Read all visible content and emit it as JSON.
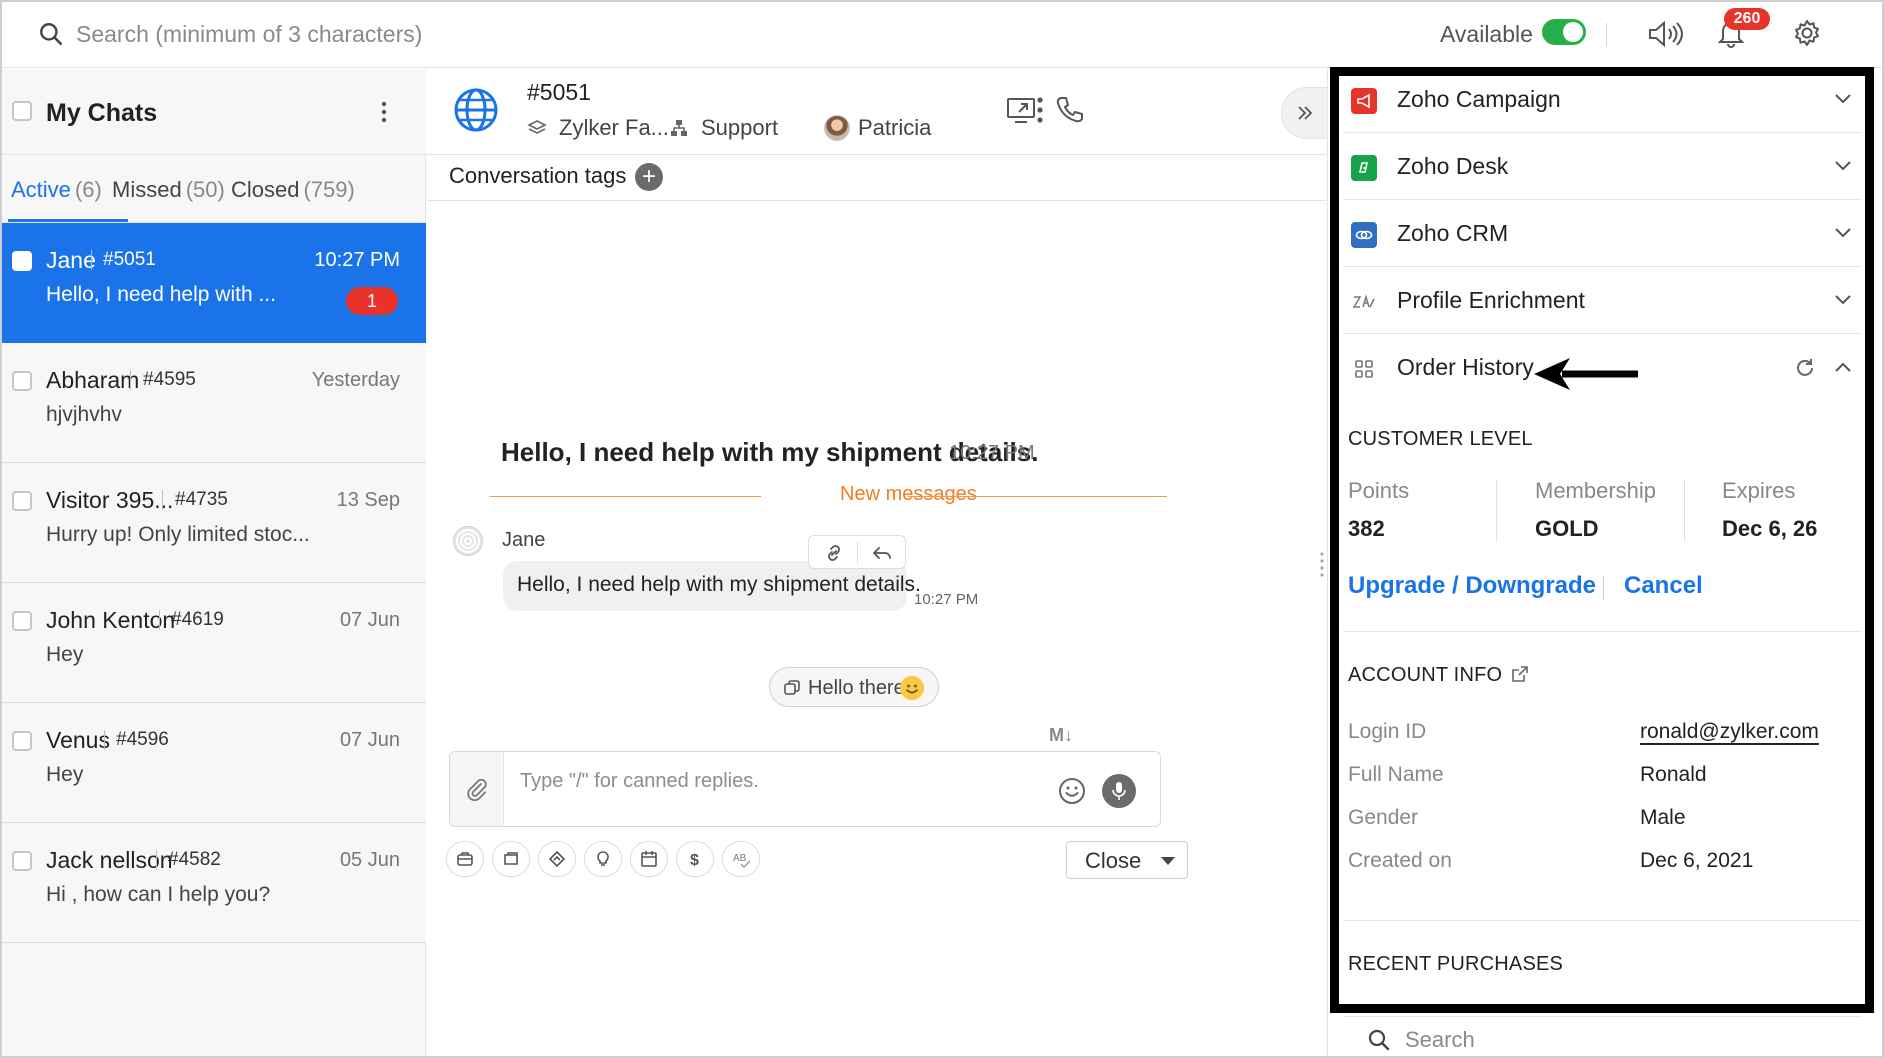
{
  "topbar": {
    "search_placeholder": "Search (minimum of 3 characters)",
    "availability_label": "Available",
    "availability_on": true,
    "notification_count": "260"
  },
  "sidebar": {
    "title": "My Chats",
    "tabs": [
      {
        "label": "Active",
        "count": "(6)",
        "active": true
      },
      {
        "label": "Missed",
        "count": "(50)",
        "active": false
      },
      {
        "label": "Closed",
        "count": "(759)",
        "active": false
      }
    ],
    "chats": [
      {
        "name": "Jane",
        "id": "#5051",
        "time": "10:27 PM",
        "preview": "Hello, I need help with ...",
        "unread": "1",
        "selected": true
      },
      {
        "name": "Abharam",
        "id": "#4595",
        "time": "Yesterday",
        "preview": "hjvjhvhv"
      },
      {
        "name": "Visitor 395...",
        "id": "#4735",
        "time": "13 Sep",
        "preview": "Hurry up! Only limited stoc..."
      },
      {
        "name": "John Kenton",
        "id": "#4619",
        "time": "07 Jun",
        "preview": "Hey"
      },
      {
        "name": "Venus",
        "id": "#4596",
        "time": "07 Jun",
        "preview": "Hey"
      },
      {
        "name": "Jack nellson",
        "id": "#4582",
        "time": "05 Jun",
        "preview": "Hi , how can I help you?"
      }
    ]
  },
  "conversation": {
    "id": "#5051",
    "brand": "Zylker Fa...",
    "department": "Support",
    "agent": "Patricia",
    "tags_label": "Conversation tags",
    "first_message": "Hello, I need help with my shipment details.",
    "first_message_time": "10:27 PM",
    "new_messages_label": "New messages",
    "sender": "Jane",
    "bubble_text": "Hello, I need help with my shipment details.",
    "bubble_time": "10:27 PM",
    "suggestion_chip": "Hello there",
    "markdown_label": "M↓",
    "composer_placeholder": "Type \"/\" for canned replies.",
    "close_label": "Close"
  },
  "right_panel": {
    "integrations": [
      {
        "label": "Zoho Campaign",
        "color": "#e8332b",
        "icon": "campaign-icon"
      },
      {
        "label": "Zoho Desk",
        "color": "#17a34a",
        "icon": "desk-icon"
      },
      {
        "label": "Zoho CRM",
        "color": "#2f6fc4",
        "icon": "crm-icon"
      },
      {
        "label": "Profile Enrichment",
        "color": "#ffffff",
        "icon": "enrichment-icon"
      },
      {
        "label": "Order History",
        "color": "#ffffff",
        "icon": "apps-icon",
        "expanded": true
      }
    ],
    "customer_level": {
      "title": "CUSTOMER LEVEL",
      "points_label": "Points",
      "points_value": "382",
      "membership_label": "Membership",
      "membership_value": "GOLD",
      "expires_label": "Expires",
      "expires_value": "Dec 6, 26",
      "upgrade_link": "Upgrade / Downgrade",
      "cancel_link": "Cancel"
    },
    "account_info": {
      "title": "ACCOUNT INFO",
      "rows": [
        {
          "label": "Login ID",
          "value": "ronald@zylker.com"
        },
        {
          "label": "Full Name",
          "value": "Ronald"
        },
        {
          "label": "Gender",
          "value": "Male"
        },
        {
          "label": "Created on",
          "value": "Dec 6, 2021"
        }
      ]
    },
    "recent_purchases_title": "RECENT PURCHASES",
    "search_placeholder": "Search"
  },
  "colors": {
    "accent": "#1a73e8",
    "badge": "#e8332b",
    "toggle_on": "#27b04a",
    "new_messages": "#f27d22"
  }
}
